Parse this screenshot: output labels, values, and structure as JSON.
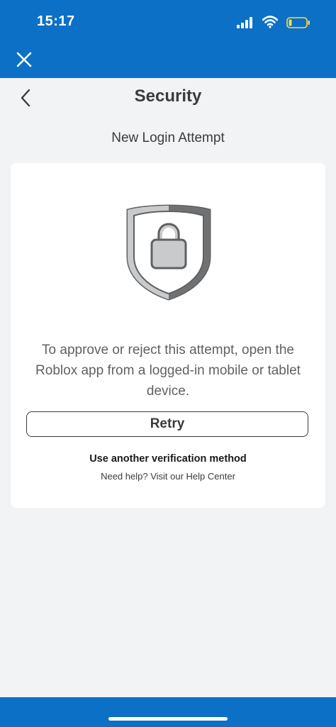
{
  "status_bar": {
    "time": "15:17"
  },
  "header": {
    "title": "Security"
  },
  "subtitle": "New Login Attempt",
  "card": {
    "message": "To approve or reject this attempt, open the Roblox app from a logged-in mobile or tablet device.",
    "retry_label": "Retry",
    "alt_method_label": "Use another verification method",
    "help_prefix": "Need help? Visit our ",
    "help_link_label": "Help Center"
  },
  "icons": {
    "close": "close-icon",
    "back": "chevron-left-icon",
    "shield": "shield-lock-icon"
  },
  "colors": {
    "brand_blue": "#0b70c6",
    "background": "#f2f3f5",
    "text_dark": "#393b3d",
    "text_muted": "#606162"
  }
}
